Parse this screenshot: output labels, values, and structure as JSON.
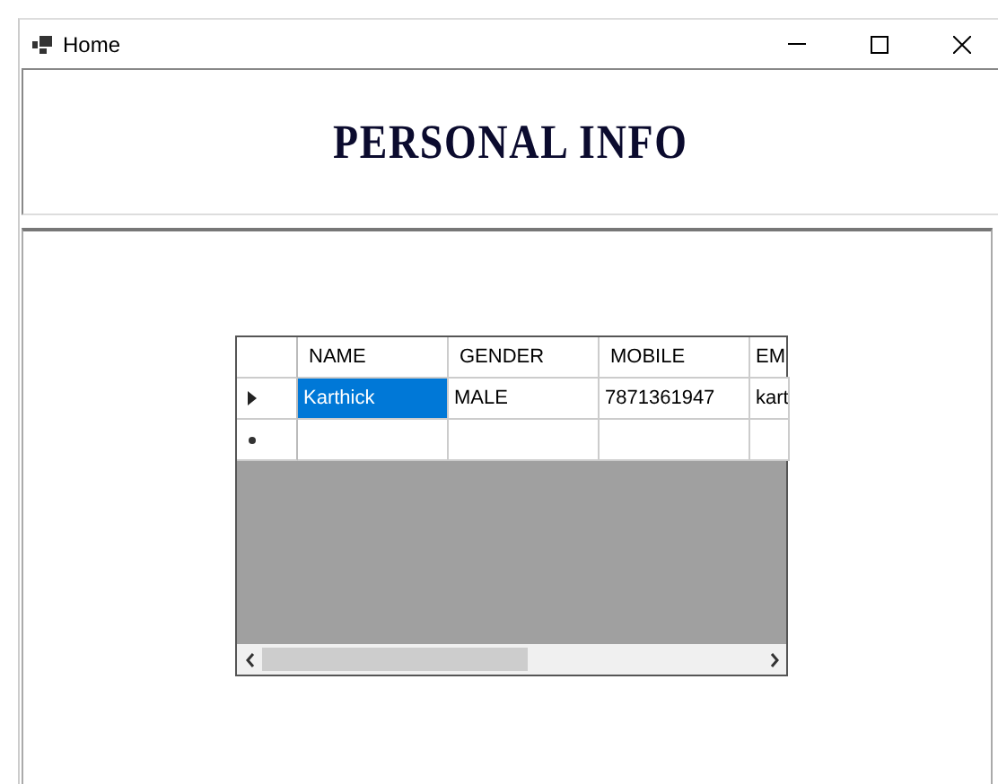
{
  "window": {
    "title": "Home"
  },
  "header": {
    "title": "PERSONAL INFO"
  },
  "grid": {
    "columns": [
      "NAME",
      "GENDER",
      "MOBILE",
      "EM"
    ],
    "rows": [
      {
        "kind": "current",
        "cells": [
          {
            "text": "Karthick",
            "selected": true
          },
          {
            "text": "MALE",
            "selected": false
          },
          {
            "text": "7871361947",
            "selected": false
          },
          {
            "text": "kart",
            "selected": false
          }
        ]
      },
      {
        "kind": "new",
        "cells": [
          {
            "text": "",
            "selected": false
          },
          {
            "text": "",
            "selected": false
          },
          {
            "text": "",
            "selected": false
          },
          {
            "text": "",
            "selected": false
          }
        ]
      }
    ]
  }
}
